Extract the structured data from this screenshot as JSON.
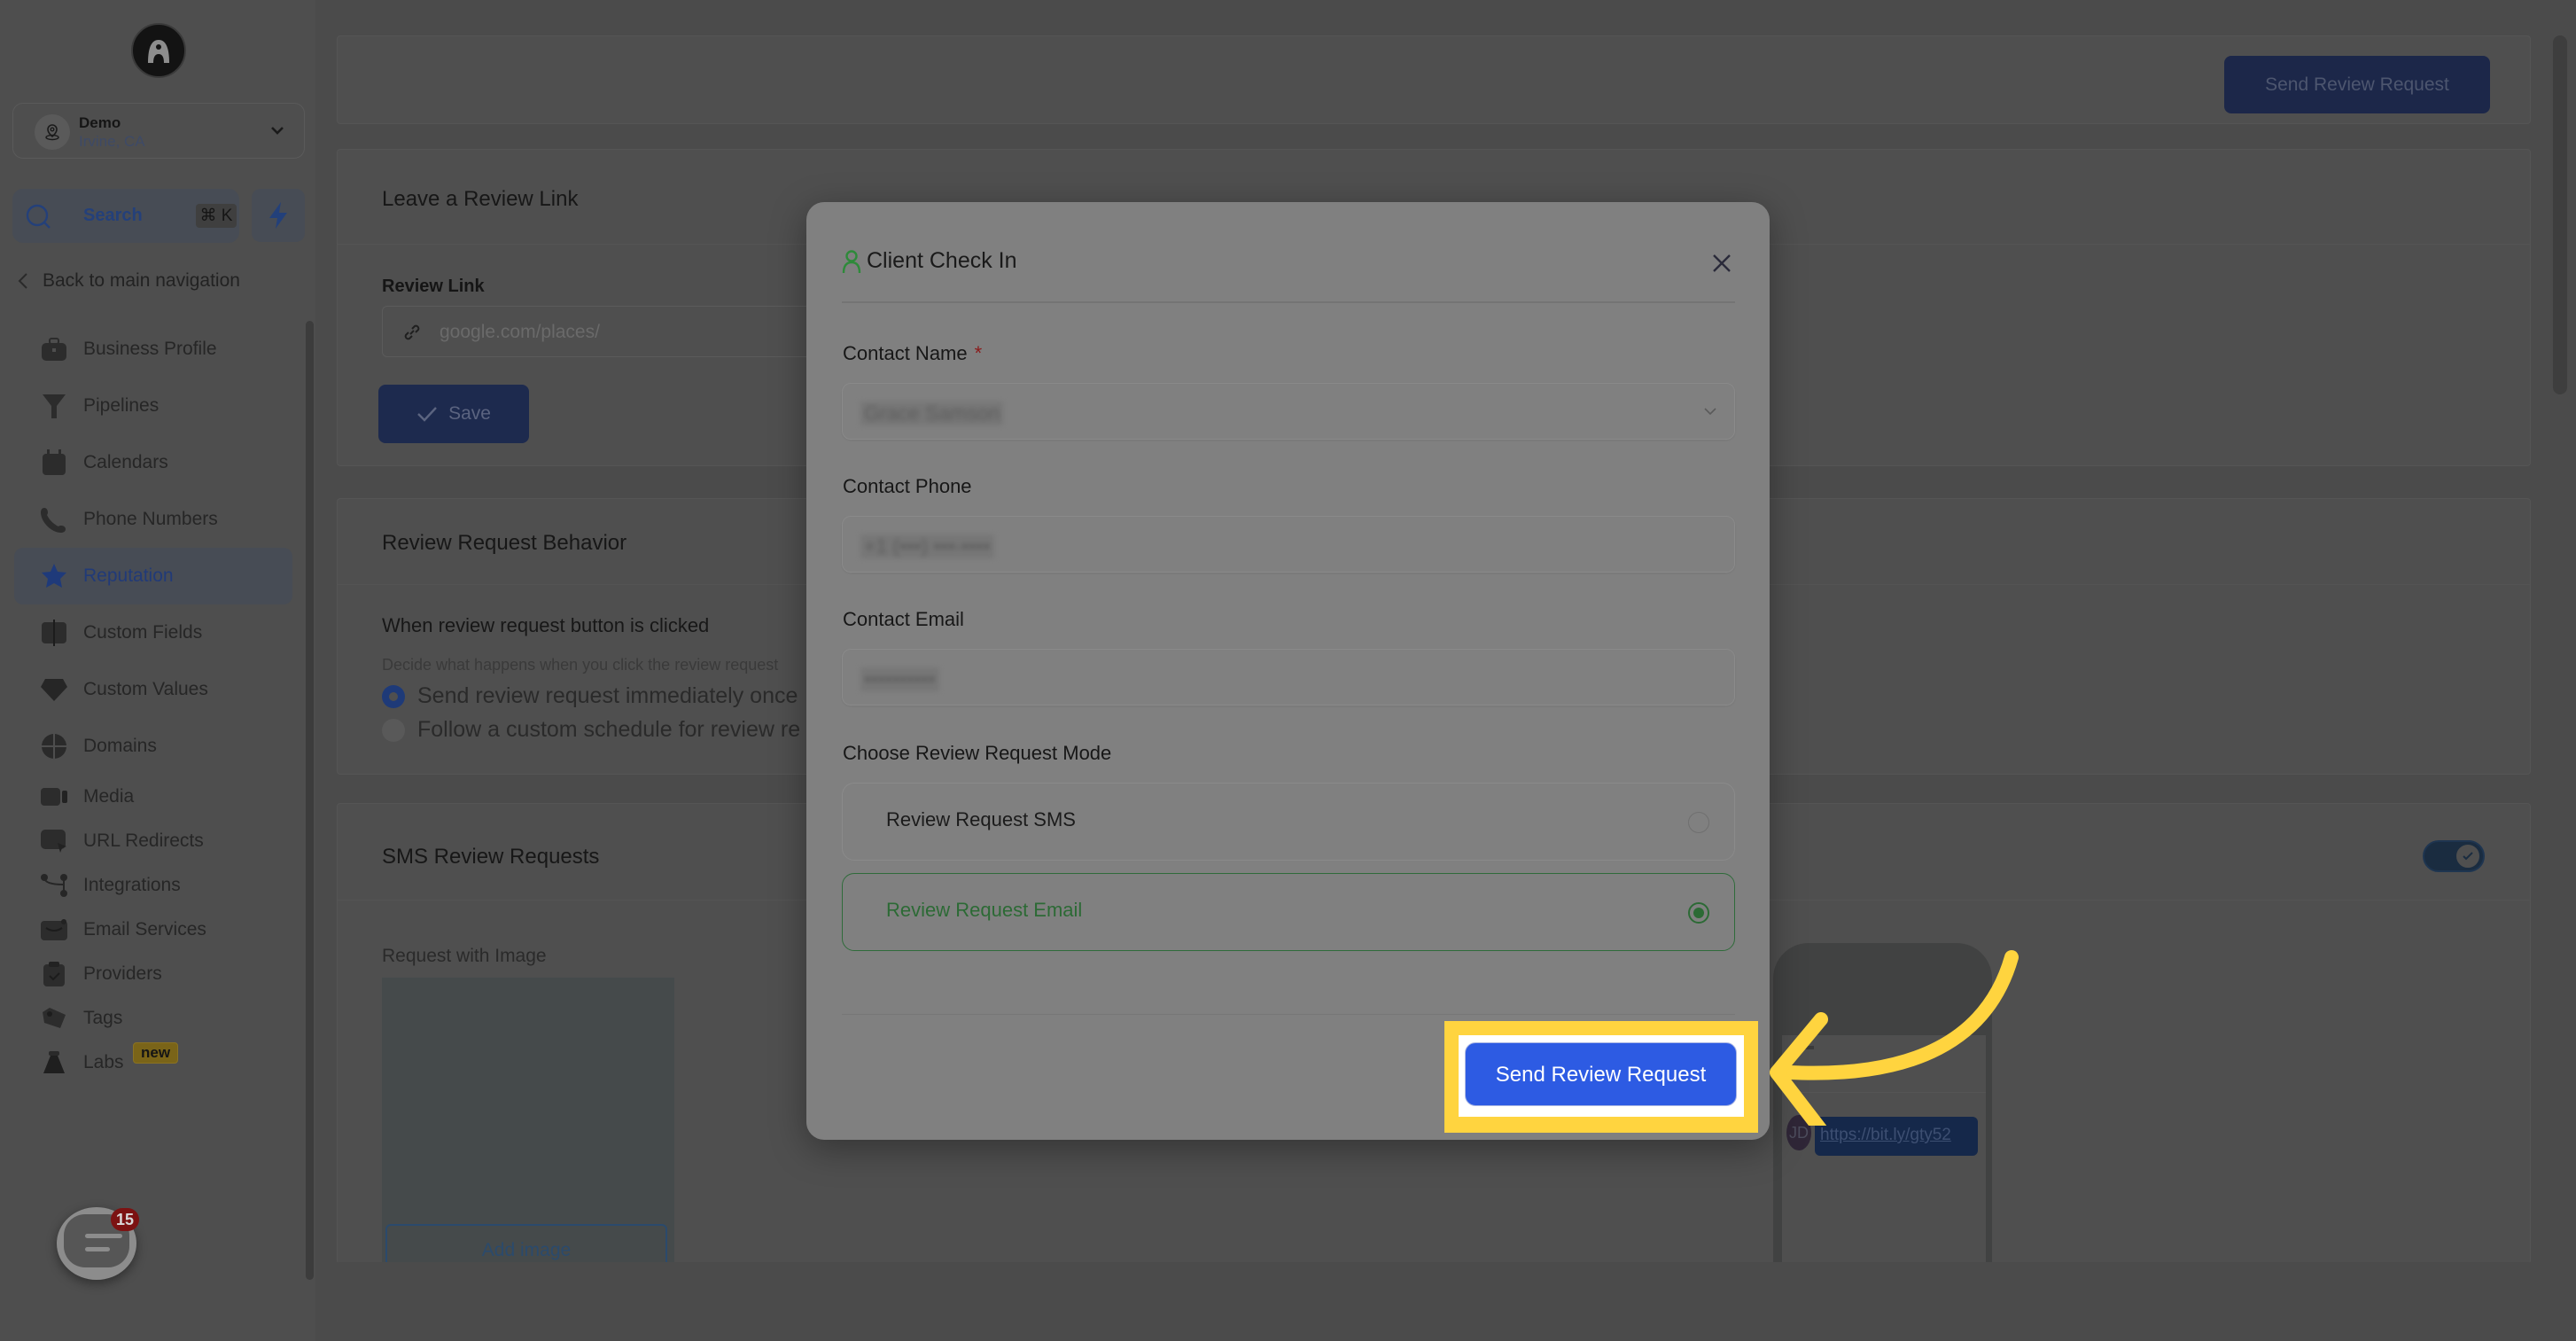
{
  "sidebar": {
    "location": {
      "name": "Demo",
      "subtitle": "Irvine, CA"
    },
    "search": {
      "label": "Search",
      "shortcut": "⌘ K"
    },
    "back_label": "Back to main navigation",
    "items": [
      {
        "label": "Business Profile",
        "icon": "briefcase-icon"
      },
      {
        "label": "Pipelines",
        "icon": "funnel-icon"
      },
      {
        "label": "Calendars",
        "icon": "calendar-icon"
      },
      {
        "label": "Phone Numbers",
        "icon": "phone-icon"
      },
      {
        "label": "Reputation",
        "icon": "star-icon",
        "active": true
      },
      {
        "label": "Custom Fields",
        "icon": "custom-fields-icon"
      },
      {
        "label": "Custom Values",
        "icon": "diamond-icon"
      },
      {
        "label": "Domains",
        "icon": "globe-icon"
      },
      {
        "label": "Media",
        "icon": "video-icon"
      },
      {
        "label": "URL Redirects",
        "icon": "redirect-icon"
      },
      {
        "label": "Integrations",
        "icon": "integrations-icon"
      },
      {
        "label": "Email Services",
        "icon": "email-icon"
      },
      {
        "label": "Providers",
        "icon": "clipboard-icon"
      },
      {
        "label": "Tags",
        "icon": "tag-icon"
      },
      {
        "label": "Labs",
        "icon": "flask-icon",
        "badge": "new"
      }
    ],
    "chat_badge_count": "15"
  },
  "topbar": {
    "send_review_label": "Send Review Request"
  },
  "review_link_card": {
    "title": "Leave a Review Link",
    "field_label": "Review Link",
    "placeholder": "google.com/places/",
    "save_label": "Save"
  },
  "behavior_card": {
    "title": "Review Request Behavior",
    "question": "When review request button is clicked",
    "description": "Decide what happens when you click the review request",
    "options": [
      {
        "label": "Send review request immediately once",
        "selected": true
      },
      {
        "label": "Follow a custom schedule for review re",
        "selected": false
      }
    ]
  },
  "sms_card": {
    "title": "SMS Review Requests",
    "image_label": "Request with Image",
    "add_image_label": "Add image",
    "toggle_on": true,
    "preview": {
      "avatar_initials": "JD",
      "message_link": "https://bit.ly/gty52"
    }
  },
  "modal": {
    "title": "Client Check In",
    "contact_name": {
      "label": "Contact Name",
      "required_mark": "*",
      "value": "Grace Samson"
    },
    "contact_phone": {
      "label": "Contact Phone",
      "value": "+1 (•••) •••-••••"
    },
    "contact_email": {
      "label": "Contact Email",
      "value": "••••••••••"
    },
    "mode": {
      "label": "Choose Review Request Mode",
      "options": [
        {
          "label": "Review Request SMS",
          "selected": false
        },
        {
          "label": "Review Request Email",
          "selected": true
        }
      ]
    },
    "submit_label": "Send Review Request"
  },
  "colors": {
    "primary": "#2d5be3",
    "selected_green": "#2c6a35",
    "highlight": "#ffd43f",
    "required": "#8a1a1a"
  }
}
